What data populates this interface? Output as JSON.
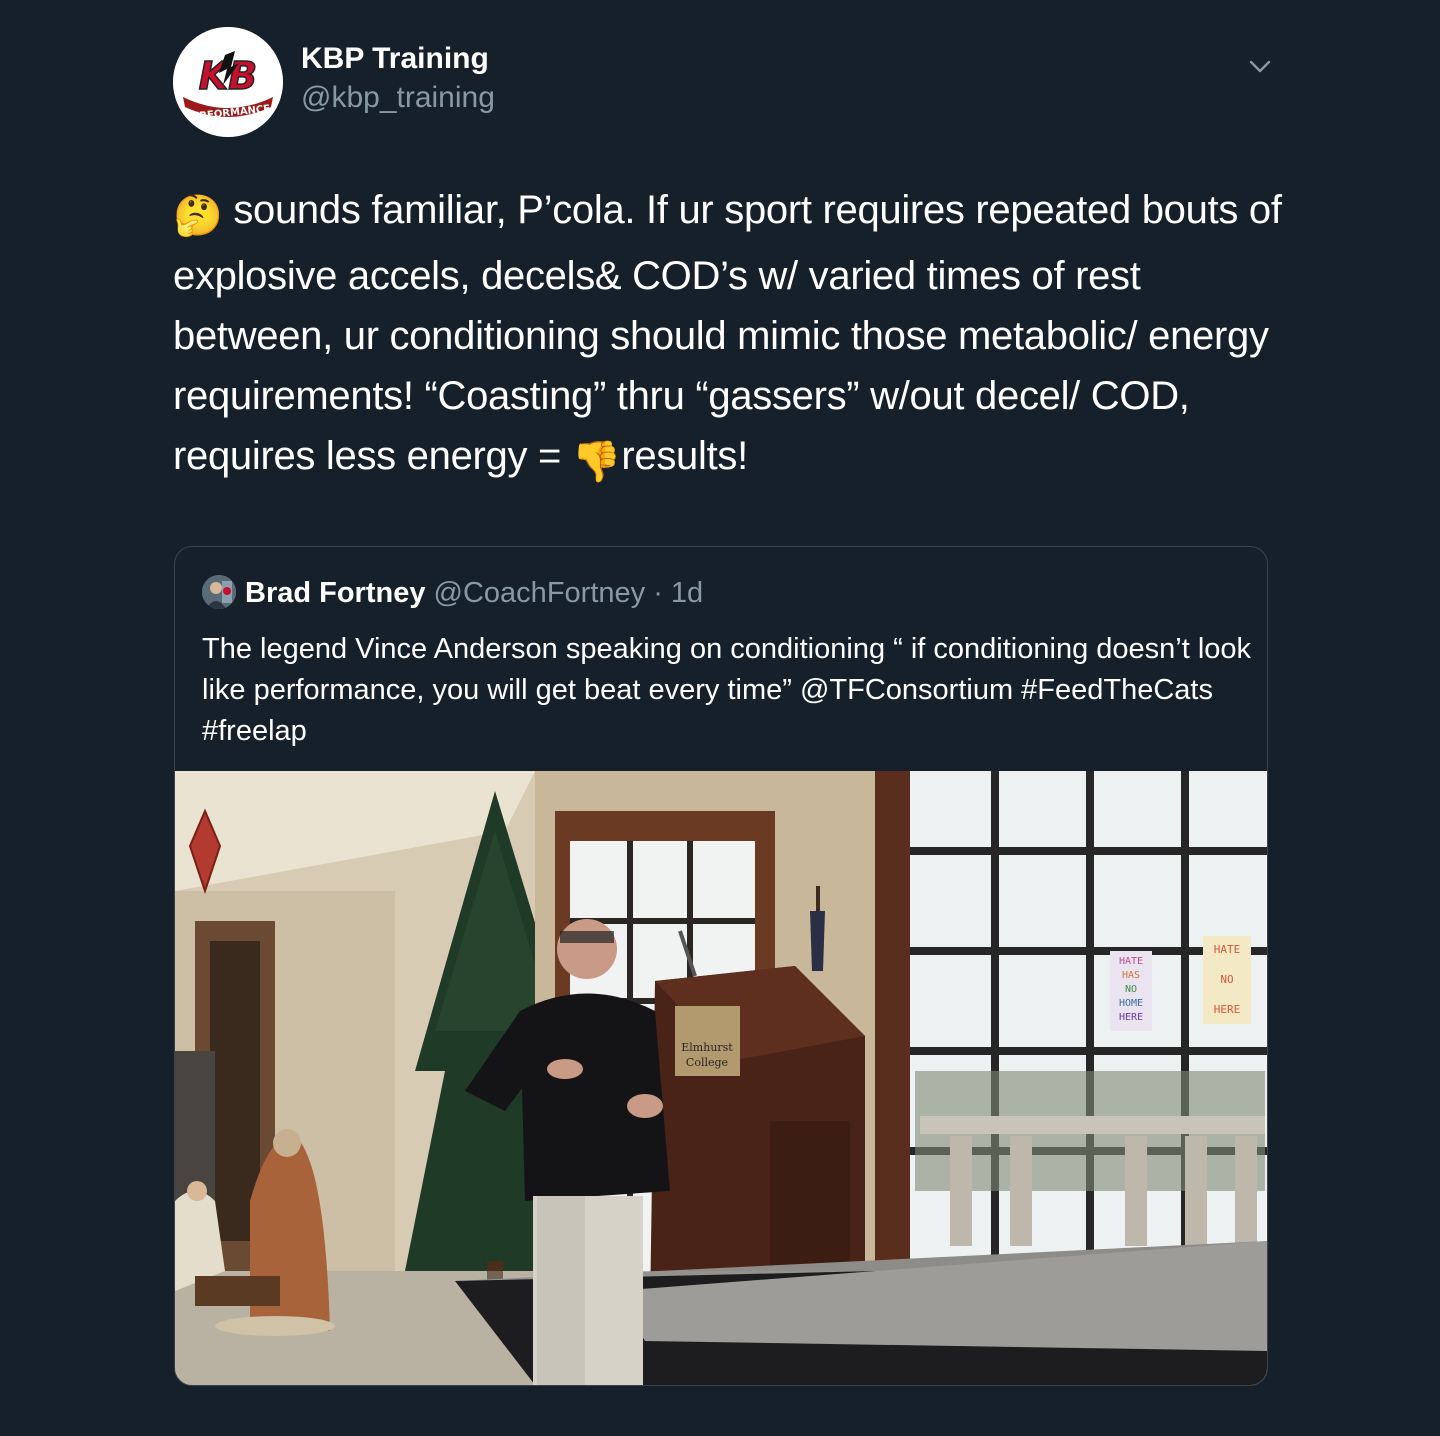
{
  "tweet": {
    "author": {
      "display_name": "KBP Training",
      "handle": "@kbp_training",
      "avatar_text": "KB",
      "avatar_subtext": "PERFORMANCE"
    },
    "text_segments": {
      "emoji_thinking": "🤔",
      "part1": " sounds familiar, P’cola. If ur sport requires repeated bouts of explosive accels, decels& COD’s w/ varied times of rest between, ur conditioning should mimic those metabolic/ energy requirements! “Coasting” thru “gassers” w/out decel/ COD, requires less energy = ",
      "emoji_thumbs_down": "👎",
      "part2": "results!"
    },
    "menu_icon": "chevron-down-icon"
  },
  "quoted_tweet": {
    "author": {
      "display_name": "Brad Fortney",
      "handle": "@CoachFortney",
      "separator": " · ",
      "time": "1d"
    },
    "text": "The legend Vince Anderson speaking on conditioning “ if conditioning doesn’t look like performance, you will get beat every time” @TFConsortium #FeedTheCats #freelap",
    "photo": {
      "podium_label_line1": "Elmhurst",
      "podium_label_line2": "College",
      "window_sign1": [
        "HATE",
        "HAS",
        "NO",
        "HOME",
        "HERE"
      ],
      "window_sign2": [
        "HATE",
        "NO",
        "HERE"
      ]
    }
  },
  "colors": {
    "background": "#15202b",
    "secondary_text": "#8899a6",
    "border": "#38444d",
    "brand_red": "#c8102e"
  }
}
